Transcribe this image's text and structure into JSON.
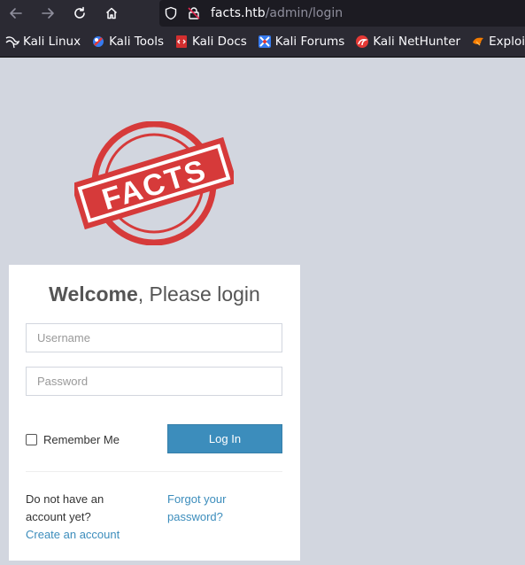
{
  "browser": {
    "url_host": "facts.htb",
    "url_path": "/admin/login"
  },
  "bookmarks": [
    {
      "label": "Kali Linux",
      "icon": "kali-dragon-icon"
    },
    {
      "label": "Kali Tools",
      "icon": "kali-tools-icon"
    },
    {
      "label": "Kali Docs",
      "icon": "kali-docs-icon"
    },
    {
      "label": "Kali Forums",
      "icon": "kali-forums-icon"
    },
    {
      "label": "Kali NetHunter",
      "icon": "kali-nethunter-icon"
    },
    {
      "label": "Exploit-DB",
      "icon": "exploit-db-icon"
    }
  ],
  "logo": {
    "text": "FACTS",
    "color": "#d63a3a"
  },
  "login": {
    "title_bold": "Welcome",
    "title_rest": ", Please login",
    "username_placeholder": "Username",
    "password_placeholder": "Password",
    "remember_label": "Remember Me",
    "button_label": "Log In",
    "signup_prompt": "Do not have an account yet?",
    "signup_link": "Create an account",
    "forgot_link": "Forgot your password?"
  },
  "colors": {
    "primary": "#3c8dbc",
    "page_bg": "#d2d6df",
    "toolbar_bg": "#2b2a33"
  }
}
